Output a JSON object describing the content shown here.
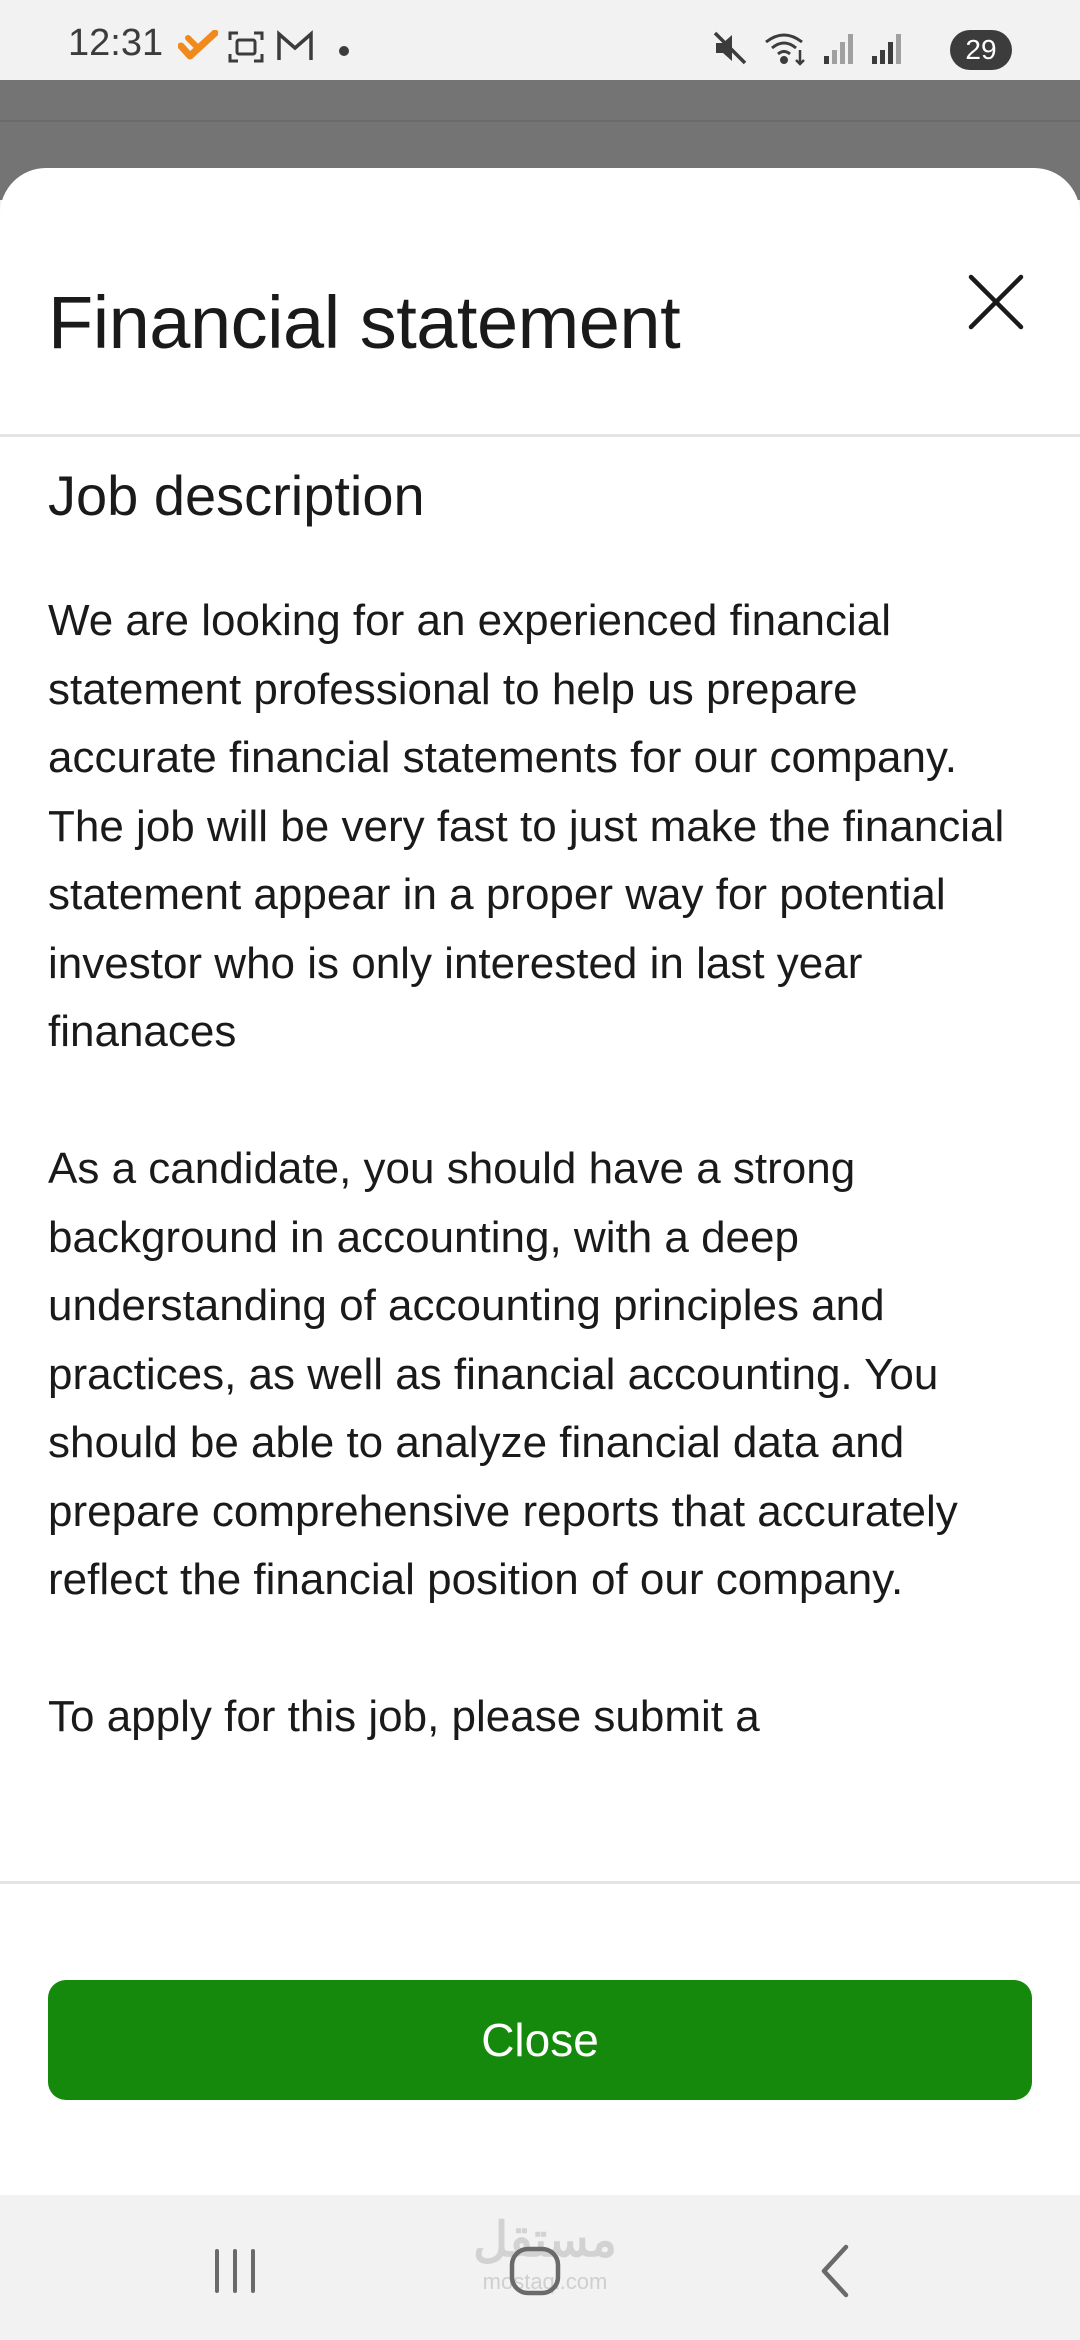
{
  "status_bar": {
    "time": "12:31",
    "battery": "29",
    "left_icons": [
      "app-notification-icon",
      "screenshot-icon",
      "gmail-icon",
      "dot-icon"
    ],
    "right_icons": [
      "mute-icon",
      "wifi-icon",
      "signal-icon",
      "signal-icon"
    ]
  },
  "sheet": {
    "title": "Financial statement",
    "close_icon": "close-icon",
    "section_heading": "Job description",
    "paragraphs": [
      "We are looking for an experienced financial statement professional to help us prepare accurate financial statements for our company. The job will be very fast to just make the financial statement appear in a proper way for potential investor who is only interested in last year finanaces",
      "As a candidate, you should have a strong background in accounting, with a deep understanding of accounting principles and practices, as well as financial accounting. You should be able to analyze financial data and prepare comprehensive reports that accurately reflect the financial position of our company.",
      "To apply for this job, please submit a"
    ],
    "close_button_label": "Close",
    "accent_color": "#14890b"
  },
  "nav_bar": {
    "buttons": [
      "recent-apps-icon",
      "home-icon",
      "back-icon"
    ],
    "watermark_main": "مستقل",
    "watermark_sub": "mostaql.com"
  }
}
